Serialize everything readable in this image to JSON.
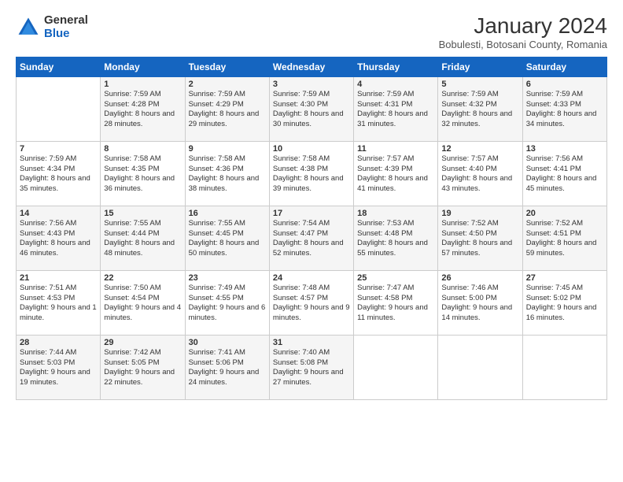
{
  "logo": {
    "general": "General",
    "blue": "Blue"
  },
  "title": "January 2024",
  "subtitle": "Bobulesti, Botosani County, Romania",
  "weekdays": [
    "Sunday",
    "Monday",
    "Tuesday",
    "Wednesday",
    "Thursday",
    "Friday",
    "Saturday"
  ],
  "weeks": [
    [
      {
        "day": "",
        "sunrise": "",
        "sunset": "",
        "daylight": ""
      },
      {
        "day": "1",
        "sunrise": "Sunrise: 7:59 AM",
        "sunset": "Sunset: 4:28 PM",
        "daylight": "Daylight: 8 hours and 28 minutes."
      },
      {
        "day": "2",
        "sunrise": "Sunrise: 7:59 AM",
        "sunset": "Sunset: 4:29 PM",
        "daylight": "Daylight: 8 hours and 29 minutes."
      },
      {
        "day": "3",
        "sunrise": "Sunrise: 7:59 AM",
        "sunset": "Sunset: 4:30 PM",
        "daylight": "Daylight: 8 hours and 30 minutes."
      },
      {
        "day": "4",
        "sunrise": "Sunrise: 7:59 AM",
        "sunset": "Sunset: 4:31 PM",
        "daylight": "Daylight: 8 hours and 31 minutes."
      },
      {
        "day": "5",
        "sunrise": "Sunrise: 7:59 AM",
        "sunset": "Sunset: 4:32 PM",
        "daylight": "Daylight: 8 hours and 32 minutes."
      },
      {
        "day": "6",
        "sunrise": "Sunrise: 7:59 AM",
        "sunset": "Sunset: 4:33 PM",
        "daylight": "Daylight: 8 hours and 34 minutes."
      }
    ],
    [
      {
        "day": "7",
        "sunrise": "Sunrise: 7:59 AM",
        "sunset": "Sunset: 4:34 PM",
        "daylight": "Daylight: 8 hours and 35 minutes."
      },
      {
        "day": "8",
        "sunrise": "Sunrise: 7:58 AM",
        "sunset": "Sunset: 4:35 PM",
        "daylight": "Daylight: 8 hours and 36 minutes."
      },
      {
        "day": "9",
        "sunrise": "Sunrise: 7:58 AM",
        "sunset": "Sunset: 4:36 PM",
        "daylight": "Daylight: 8 hours and 38 minutes."
      },
      {
        "day": "10",
        "sunrise": "Sunrise: 7:58 AM",
        "sunset": "Sunset: 4:38 PM",
        "daylight": "Daylight: 8 hours and 39 minutes."
      },
      {
        "day": "11",
        "sunrise": "Sunrise: 7:57 AM",
        "sunset": "Sunset: 4:39 PM",
        "daylight": "Daylight: 8 hours and 41 minutes."
      },
      {
        "day": "12",
        "sunrise": "Sunrise: 7:57 AM",
        "sunset": "Sunset: 4:40 PM",
        "daylight": "Daylight: 8 hours and 43 minutes."
      },
      {
        "day": "13",
        "sunrise": "Sunrise: 7:56 AM",
        "sunset": "Sunset: 4:41 PM",
        "daylight": "Daylight: 8 hours and 45 minutes."
      }
    ],
    [
      {
        "day": "14",
        "sunrise": "Sunrise: 7:56 AM",
        "sunset": "Sunset: 4:43 PM",
        "daylight": "Daylight: 8 hours and 46 minutes."
      },
      {
        "day": "15",
        "sunrise": "Sunrise: 7:55 AM",
        "sunset": "Sunset: 4:44 PM",
        "daylight": "Daylight: 8 hours and 48 minutes."
      },
      {
        "day": "16",
        "sunrise": "Sunrise: 7:55 AM",
        "sunset": "Sunset: 4:45 PM",
        "daylight": "Daylight: 8 hours and 50 minutes."
      },
      {
        "day": "17",
        "sunrise": "Sunrise: 7:54 AM",
        "sunset": "Sunset: 4:47 PM",
        "daylight": "Daylight: 8 hours and 52 minutes."
      },
      {
        "day": "18",
        "sunrise": "Sunrise: 7:53 AM",
        "sunset": "Sunset: 4:48 PM",
        "daylight": "Daylight: 8 hours and 55 minutes."
      },
      {
        "day": "19",
        "sunrise": "Sunrise: 7:52 AM",
        "sunset": "Sunset: 4:50 PM",
        "daylight": "Daylight: 8 hours and 57 minutes."
      },
      {
        "day": "20",
        "sunrise": "Sunrise: 7:52 AM",
        "sunset": "Sunset: 4:51 PM",
        "daylight": "Daylight: 8 hours and 59 minutes."
      }
    ],
    [
      {
        "day": "21",
        "sunrise": "Sunrise: 7:51 AM",
        "sunset": "Sunset: 4:53 PM",
        "daylight": "Daylight: 9 hours and 1 minute."
      },
      {
        "day": "22",
        "sunrise": "Sunrise: 7:50 AM",
        "sunset": "Sunset: 4:54 PM",
        "daylight": "Daylight: 9 hours and 4 minutes."
      },
      {
        "day": "23",
        "sunrise": "Sunrise: 7:49 AM",
        "sunset": "Sunset: 4:55 PM",
        "daylight": "Daylight: 9 hours and 6 minutes."
      },
      {
        "day": "24",
        "sunrise": "Sunrise: 7:48 AM",
        "sunset": "Sunset: 4:57 PM",
        "daylight": "Daylight: 9 hours and 9 minutes."
      },
      {
        "day": "25",
        "sunrise": "Sunrise: 7:47 AM",
        "sunset": "Sunset: 4:58 PM",
        "daylight": "Daylight: 9 hours and 11 minutes."
      },
      {
        "day": "26",
        "sunrise": "Sunrise: 7:46 AM",
        "sunset": "Sunset: 5:00 PM",
        "daylight": "Daylight: 9 hours and 14 minutes."
      },
      {
        "day": "27",
        "sunrise": "Sunrise: 7:45 AM",
        "sunset": "Sunset: 5:02 PM",
        "daylight": "Daylight: 9 hours and 16 minutes."
      }
    ],
    [
      {
        "day": "28",
        "sunrise": "Sunrise: 7:44 AM",
        "sunset": "Sunset: 5:03 PM",
        "daylight": "Daylight: 9 hours and 19 minutes."
      },
      {
        "day": "29",
        "sunrise": "Sunrise: 7:42 AM",
        "sunset": "Sunset: 5:05 PM",
        "daylight": "Daylight: 9 hours and 22 minutes."
      },
      {
        "day": "30",
        "sunrise": "Sunrise: 7:41 AM",
        "sunset": "Sunset: 5:06 PM",
        "daylight": "Daylight: 9 hours and 24 minutes."
      },
      {
        "day": "31",
        "sunrise": "Sunrise: 7:40 AM",
        "sunset": "Sunset: 5:08 PM",
        "daylight": "Daylight: 9 hours and 27 minutes."
      },
      {
        "day": "",
        "sunrise": "",
        "sunset": "",
        "daylight": ""
      },
      {
        "day": "",
        "sunrise": "",
        "sunset": "",
        "daylight": ""
      },
      {
        "day": "",
        "sunrise": "",
        "sunset": "",
        "daylight": ""
      }
    ]
  ]
}
